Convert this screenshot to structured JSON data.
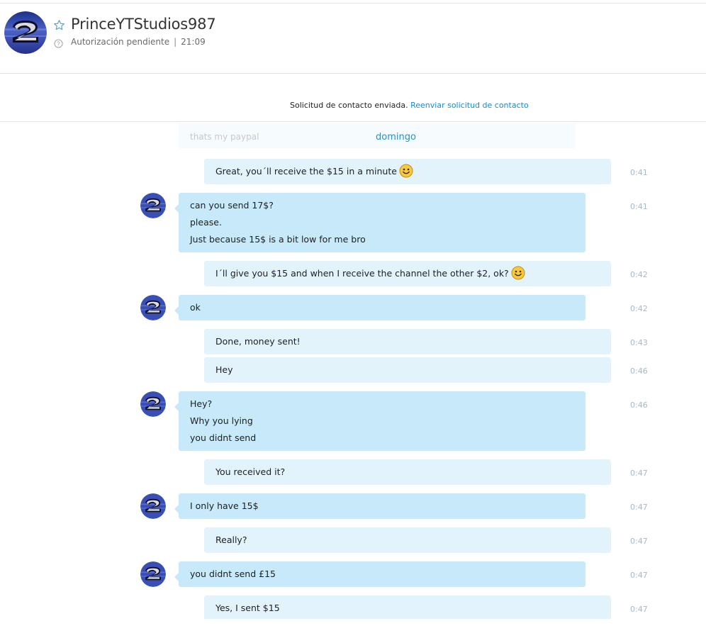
{
  "header": {
    "contact_name": "PrinceYTStudios987",
    "status": "Autorización pendiente",
    "time": "21:09"
  },
  "request_bar": {
    "text": "Solicitud de contacto enviada.",
    "link": "Reenviar solicitud de contacto"
  },
  "chat": {
    "faded_text": "thats my paypal",
    "day_separator": "domingo",
    "messages": [
      {
        "from": "me",
        "lines": [
          "Great, you´ll receive the $15 in a minute"
        ],
        "emoji": "smiley",
        "time": "0:41"
      },
      {
        "from": "them",
        "lines": [
          "can you send 17$?",
          "please.",
          "Just because 15$ is a bit low for me bro"
        ],
        "time": "0:41"
      },
      {
        "from": "me",
        "lines": [
          "I´ll give you $15 and when I receive the channel the other $2, ok?"
        ],
        "emoji": "smiley",
        "time": "0:42"
      },
      {
        "from": "them",
        "lines": [
          "ok"
        ],
        "time": "0:42"
      },
      {
        "from": "me",
        "lines": [
          "Done, money sent!"
        ],
        "time": "0:43"
      },
      {
        "from": "me",
        "lines": [
          "Hey"
        ],
        "time": "0:46"
      },
      {
        "from": "them",
        "lines": [
          "Hey?",
          "Why you lying",
          "you didnt send"
        ],
        "time": "0:46"
      },
      {
        "from": "me",
        "lines": [
          "You received it?"
        ],
        "time": "0:47"
      },
      {
        "from": "them",
        "lines": [
          "I only have 15$"
        ],
        "time": "0:47"
      },
      {
        "from": "me",
        "lines": [
          "Really?"
        ],
        "time": "0:47"
      },
      {
        "from": "them",
        "lines": [
          "you didnt send £15"
        ],
        "time": "0:47"
      },
      {
        "from": "me",
        "lines": [
          "Yes, I sent $15"
        ],
        "time": "0:47"
      }
    ]
  },
  "colors": {
    "my_bubble": "#e3f3fc",
    "their_bubble": "#c7e9f9",
    "link": "#1b8ac8",
    "timestamp": "#a9b8c2"
  }
}
